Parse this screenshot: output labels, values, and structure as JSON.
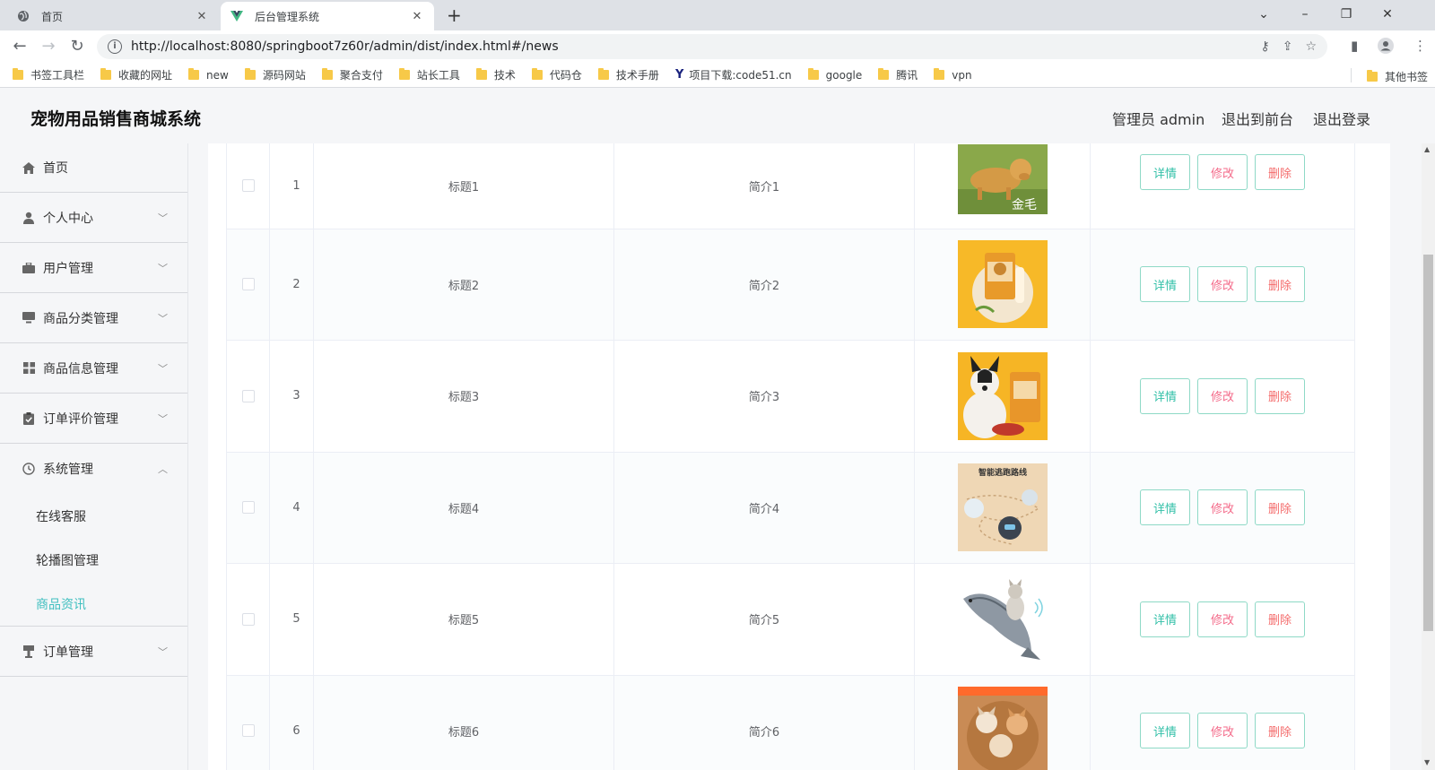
{
  "browser": {
    "tabs": [
      {
        "title": "首页",
        "active": false
      },
      {
        "title": "后台管理系统",
        "active": true
      }
    ],
    "url": "http://localhost:8080/springboot7z60r/admin/dist/index.html#/news",
    "bookmarks": [
      "书签工具栏",
      "收藏的网址",
      "new",
      "源码网站",
      "聚合支付",
      "站长工具",
      "技术",
      "代码仓",
      "技术手册",
      "项目下载:code51.cn",
      "google",
      "腾讯",
      "vpn"
    ],
    "other_bookmarks": "其他书签"
  },
  "header": {
    "title": "宠物用品销售商城系统",
    "user": "管理员 admin",
    "to_front": "退出到前台",
    "logout": "退出登录"
  },
  "sidebar": {
    "items": [
      {
        "label": "首页",
        "icon": "home-icon"
      },
      {
        "label": "个人中心",
        "icon": "user-icon"
      },
      {
        "label": "用户管理",
        "icon": "briefcase-icon"
      },
      {
        "label": "商品分类管理",
        "icon": "monitor-icon"
      },
      {
        "label": "商品信息管理",
        "icon": "grid-icon"
      },
      {
        "label": "订单评价管理",
        "icon": "clipboard-icon"
      },
      {
        "label": "系统管理",
        "icon": "clock-icon"
      },
      {
        "label": "订单管理",
        "icon": "podium-icon"
      }
    ],
    "system_sub": [
      "在线客服",
      "轮播图管理",
      "商品资讯"
    ],
    "active_sub": "商品资讯"
  },
  "table": {
    "rows": [
      {
        "index": "1",
        "title": "标题1",
        "intro": "简介1"
      },
      {
        "index": "2",
        "title": "标题2",
        "intro": "简介2"
      },
      {
        "index": "3",
        "title": "标题3",
        "intro": "简介3"
      },
      {
        "index": "4",
        "title": "标题4",
        "intro": "简介4"
      },
      {
        "index": "5",
        "title": "标题5",
        "intro": "简介5"
      },
      {
        "index": "6",
        "title": "标题6",
        "intro": "简介6"
      }
    ],
    "image_text": {
      "r1": "金毛",
      "r4": "智能逃跑路线"
    },
    "actions": {
      "detail": "详情",
      "edit": "修改",
      "delete": "删除"
    }
  },
  "colors": {
    "accent": "#3fbfbf",
    "edit": "#f46b8a",
    "delete": "#f46b6b",
    "detail": "#33c0a8"
  }
}
